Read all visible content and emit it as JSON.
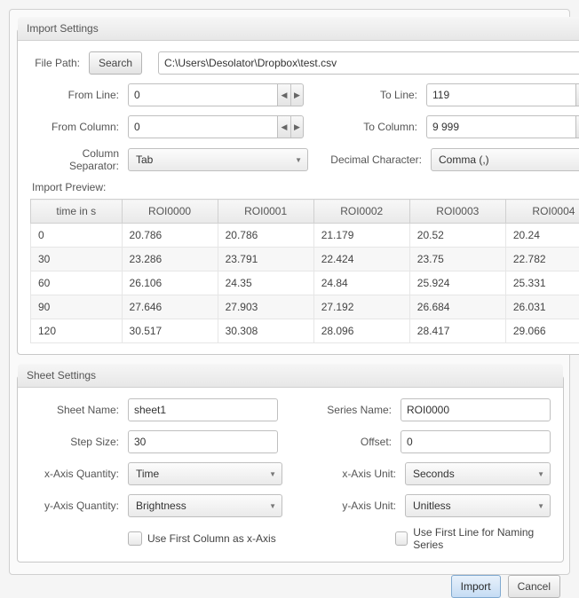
{
  "import": {
    "title": "Import Settings",
    "filePathLabel": "File Path:",
    "searchBtn": "Search",
    "filePath": "C:\\Users\\Desolator\\Dropbox\\test.csv",
    "fromLineLabel": "From Line:",
    "fromLine": "0",
    "toLineLabel": "To Line:",
    "toLine": "119",
    "fromColLabel": "From Column:",
    "fromCol": "0",
    "toColLabel": "To Column:",
    "toCol": "9 999",
    "colSepLabel": "Column Separator:",
    "colSep": "Tab",
    "decCharLabel": "Decimal Character:",
    "decChar": "Comma (,)",
    "previewLabel": "Import Preview:",
    "headers": [
      "time in s",
      "ROI0000",
      "ROI0001",
      "ROI0002",
      "ROI0003",
      "ROI0004"
    ],
    "rows": [
      [
        "0",
        "20.786",
        "20.786",
        "21.179",
        "20.52",
        "20.24"
      ],
      [
        "30",
        "23.286",
        "23.791",
        "22.424",
        "23.75",
        "22.782"
      ],
      [
        "60",
        "26.106",
        "24.35",
        "24.84",
        "25.924",
        "25.331"
      ],
      [
        "90",
        "27.646",
        "27.903",
        "27.192",
        "26.684",
        "26.031"
      ],
      [
        "120",
        "30.517",
        "30.308",
        "28.096",
        "28.417",
        "29.066"
      ]
    ]
  },
  "sheet": {
    "title": "Sheet Settings",
    "sheetNameLabel": "Sheet Name:",
    "sheetName": "sheet1",
    "seriesNameLabel": "Series Name:",
    "seriesName": "ROI0000",
    "stepSizeLabel": "Step Size:",
    "stepSize": "30",
    "offsetLabel": "Offset:",
    "offset": "0",
    "xQtyLabel": "x-Axis Quantity:",
    "xQty": "Time",
    "xUnitLabel": "x-Axis Unit:",
    "xUnit": "Seconds",
    "yQtyLabel": "y-Axis Quantity:",
    "yQty": "Brightness",
    "yUnitLabel": "y-Axis Unit:",
    "yUnit": "Unitless",
    "cbFirstCol": "Use First Column as x-Axis",
    "cbFirstLine": "Use First Line for Naming Series"
  },
  "footer": {
    "import": "Import",
    "cancel": "Cancel"
  }
}
